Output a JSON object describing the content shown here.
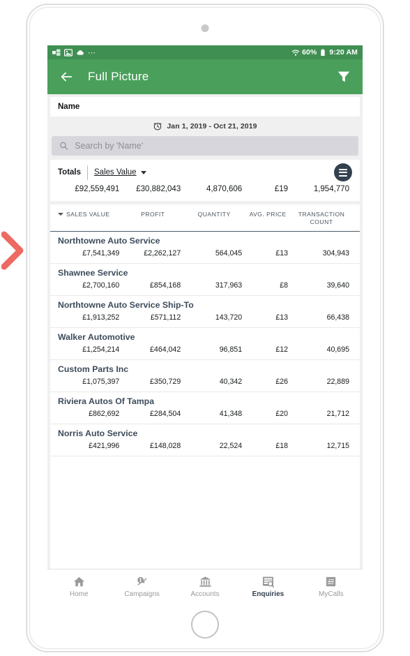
{
  "statusbar": {
    "icons": [
      "sync-icon",
      "image-icon",
      "cloud-icon"
    ],
    "overflow": "⋯",
    "battery": "60%",
    "time": "9:20 AM"
  },
  "appbar": {
    "back": "back-arrow-icon",
    "title": "Full Picture",
    "filter": "filter-icon"
  },
  "name_bar": {
    "label": "Name"
  },
  "date_range": {
    "icon": "clock-icon",
    "text": "Jan 1, 2019 - Oct 21, 2019"
  },
  "search": {
    "icon": "search-icon",
    "placeholder": "Search by 'Name'",
    "value": ""
  },
  "totals": {
    "label": "Totals",
    "metric": "Sales Value",
    "menu_icon": "hamburger-menu-icon",
    "values": [
      "£92,559,491",
      "£30,882,043",
      "4,870,606",
      "£19",
      "1,954,770"
    ]
  },
  "columns": [
    {
      "label": "SALES VALUE",
      "sorted": true
    },
    {
      "label": "PROFIT",
      "sorted": false
    },
    {
      "label": "QUANTITY",
      "sorted": false
    },
    {
      "label": "AVG. PRICE",
      "sorted": false
    },
    {
      "label": "TRANSACTION COUNT",
      "sorted": false
    }
  ],
  "rows": [
    {
      "name": "Northtowne Auto Service",
      "values": [
        "£7,541,349",
        "£2,262,127",
        "564,045",
        "£13",
        "304,943"
      ]
    },
    {
      "name": "Shawnee Service",
      "values": [
        "£2,700,160",
        "£854,168",
        "317,963",
        "£8",
        "39,640"
      ]
    },
    {
      "name": "Northtowne Auto Service Ship-To",
      "values": [
        "£1,913,252",
        "£571,112",
        "143,720",
        "£13",
        "66,438"
      ]
    },
    {
      "name": "Walker Automotive",
      "values": [
        "£1,254,214",
        "£464,042",
        "96,851",
        "£12",
        "40,695"
      ]
    },
    {
      "name": "Custom Parts Inc",
      "values": [
        "£1,075,397",
        "£350,729",
        "40,342",
        "£26",
        "22,889"
      ]
    },
    {
      "name": "Riviera Autos Of Tampa",
      "values": [
        "£862,692",
        "£284,504",
        "41,348",
        "£20",
        "21,712"
      ]
    },
    {
      "name": "Norris Auto Service",
      "values": [
        "£421,996",
        "£148,028",
        "22,524",
        "£18",
        "12,715"
      ]
    }
  ],
  "bottom_nav": [
    {
      "label": "Home",
      "icon": "home-icon",
      "active": false
    },
    {
      "label": "Campaigns",
      "icon": "campaign-money-icon",
      "active": false
    },
    {
      "label": "Accounts",
      "icon": "bank-icon",
      "active": false
    },
    {
      "label": "Enquiries",
      "icon": "enquiries-search-icon",
      "active": true
    },
    {
      "label": "MyCalls",
      "icon": "mycalls-chart-icon",
      "active": false
    }
  ],
  "theme": {
    "green": "#4aa05b",
    "status_green": "#3f8f52",
    "dark_navy": "#33414f",
    "pointer_red": "#ed6a62"
  }
}
